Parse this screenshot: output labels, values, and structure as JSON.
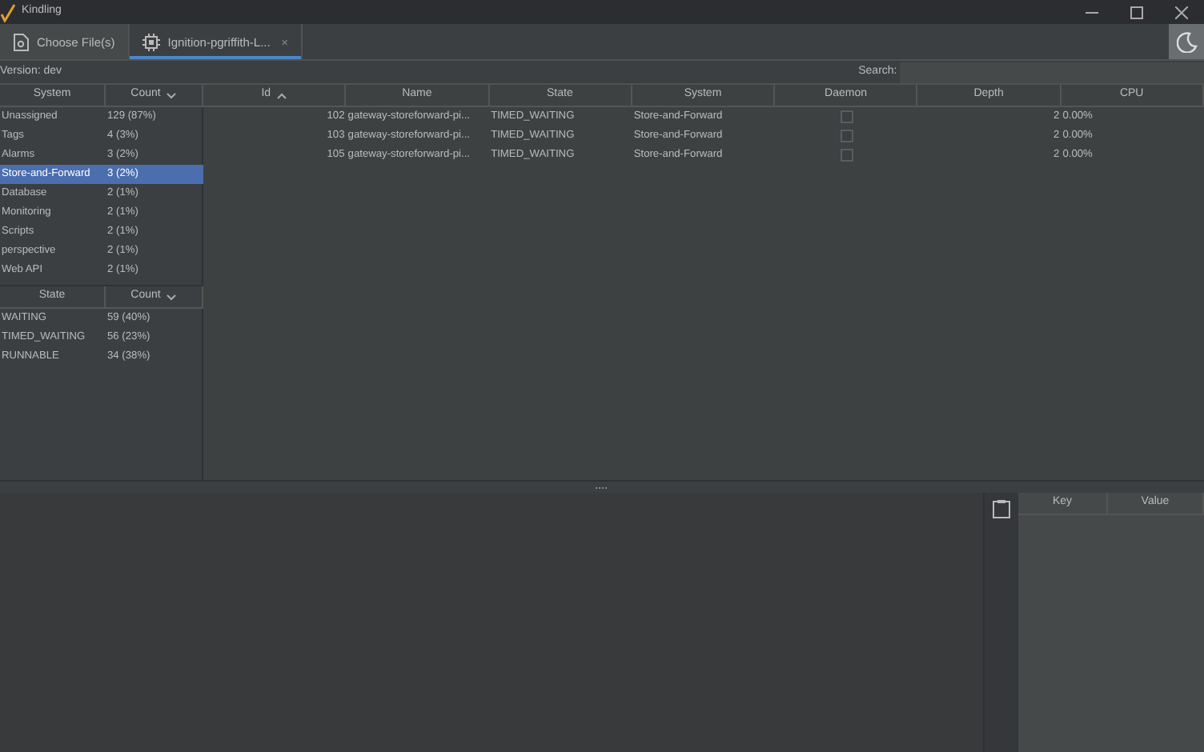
{
  "window": {
    "title": "Kindling"
  },
  "tabs": [
    {
      "label": "Choose File(s)",
      "kind": "file",
      "selected": false
    },
    {
      "label": "Ignition-pgriffith-L...",
      "kind": "archive",
      "selected": true,
      "close": "×"
    }
  ],
  "version": "Version: dev",
  "search": {
    "label": "Search:"
  },
  "system_table": {
    "columns": [
      {
        "label": "System",
        "sorted": false
      },
      {
        "label": "Count",
        "sorted": true,
        "descending": true
      }
    ],
    "rows": [
      {
        "name": "Unassigned",
        "count": "129 (87%)",
        "selected": false
      },
      {
        "name": "Tags",
        "count": "4 (3%)",
        "selected": false
      },
      {
        "name": "Alarms",
        "count": "3 (2%)",
        "selected": false
      },
      {
        "name": "Store-and-Forward",
        "count": "3 (2%)",
        "selected": true
      },
      {
        "name": "Database",
        "count": "2 (1%)",
        "selected": false
      },
      {
        "name": "Monitoring",
        "count": "2 (1%)",
        "selected": false
      },
      {
        "name": "Scripts",
        "count": "2 (1%)",
        "selected": false
      },
      {
        "name": "perspective",
        "count": "2 (1%)",
        "selected": false
      },
      {
        "name": "Web API",
        "count": "2 (1%)",
        "selected": false
      }
    ]
  },
  "state_table": {
    "columns": [
      {
        "label": "State",
        "sorted": false
      },
      {
        "label": "Count",
        "sorted": true,
        "descending": true
      }
    ],
    "rows": [
      {
        "name": "WAITING",
        "count": "59 (40%)",
        "selected": false
      },
      {
        "name": "TIMED_WAITING",
        "count": "56 (23%)",
        "selected": false
      },
      {
        "name": "RUNNABLE",
        "count": "34 (38%)",
        "selected": false
      }
    ]
  },
  "threads_table": {
    "columns": [
      {
        "label": "Id",
        "sorted": true,
        "descending": false
      },
      {
        "label": "Name",
        "sorted": false
      },
      {
        "label": "State",
        "sorted": false
      },
      {
        "label": "System",
        "sorted": false
      },
      {
        "label": "Daemon",
        "sorted": false
      },
      {
        "label": "Depth",
        "sorted": false
      },
      {
        "label": "CPU",
        "sorted": false
      }
    ],
    "rows": [
      {
        "id": "102",
        "name": "gateway-storeforward-pi...",
        "state": "TIMED_WAITING",
        "system": "Store-and-Forward",
        "daemon": false,
        "depth": "2",
        "cpu": "0.00%"
      },
      {
        "id": "103",
        "name": "gateway-storeforward-pi...",
        "state": "TIMED_WAITING",
        "system": "Store-and-Forward",
        "daemon": false,
        "depth": "2",
        "cpu": "0.00%"
      },
      {
        "id": "105",
        "name": "gateway-storeforward-pi...",
        "state": "TIMED_WAITING",
        "system": "Store-and-Forward",
        "daemon": false,
        "depth": "2",
        "cpu": "0.00%"
      }
    ]
  },
  "details_table": {
    "columns": [
      {
        "label": "Key"
      },
      {
        "label": "Value"
      }
    ]
  }
}
